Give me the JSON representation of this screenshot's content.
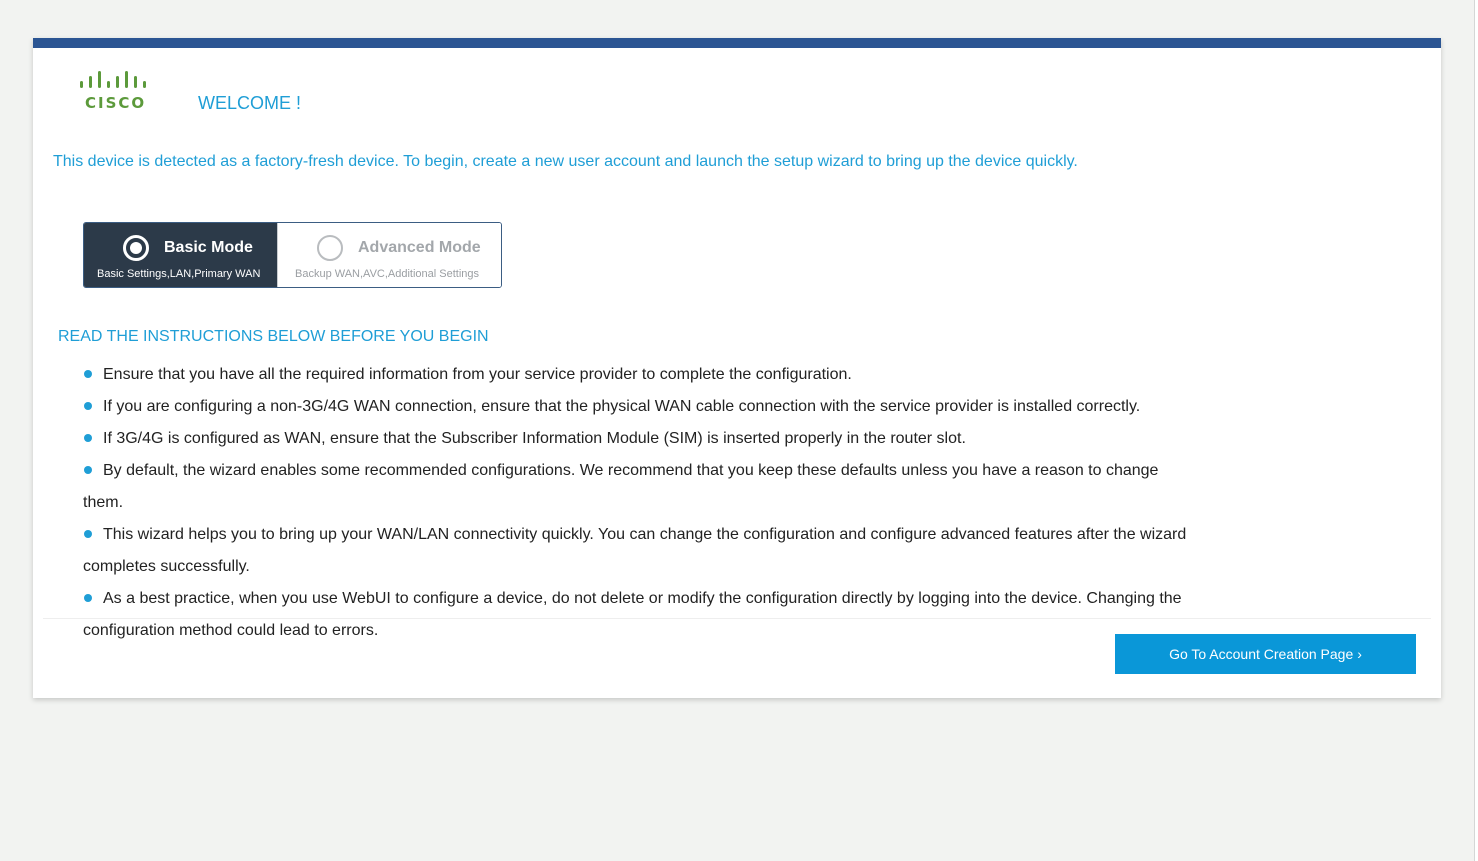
{
  "brand": {
    "logo_text": "CISCO"
  },
  "welcome_title": "WELCOME !",
  "intro_text": "This device is detected as a factory-fresh device. To begin, create a new user account and launch the setup wizard to bring up the device quickly.",
  "modes": {
    "selected": "basic",
    "basic": {
      "title": "Basic Mode",
      "subtitle": "Basic Settings,LAN,Primary WAN"
    },
    "advanced": {
      "title": "Advanced Mode",
      "subtitle": "Backup WAN,AVC,Additional Settings"
    }
  },
  "instructions": {
    "heading": "READ THE INSTRUCTIONS BELOW BEFORE YOU BEGIN",
    "items": [
      "Ensure that you have all the required information from your service provider to complete the configuration.",
      "If you are configuring a non-3G/4G WAN connection, ensure that the physical WAN cable connection with the service provider is installed correctly.",
      "If 3G/4G is configured as WAN, ensure that the Subscriber Information Module (SIM) is inserted properly in the router slot.",
      "By default, the wizard enables some recommended configurations. We recommend that you keep these defaults unless you have a reason to change them.",
      "This wizard helps you to bring up your WAN/LAN connectivity quickly. You can change the configuration and configure advanced features after the wizard completes successfully.",
      "As a best practice, when you use WebUI to configure a device, do not delete or modify the configuration directly by logging into the device. Changing the configuration method could lead to errors."
    ]
  },
  "actions": {
    "go_to_account_label": "Go To Account Creation Page",
    "go_to_account_icon": "chevron-right-icon",
    "chevron_glyph": "›"
  },
  "colors": {
    "header_bar": "#2b5593",
    "accent": "#1f9ed6",
    "button": "#0a97d8",
    "selected_mode_bg": "#2c3a49",
    "logo_green": "#5c9a3b"
  }
}
